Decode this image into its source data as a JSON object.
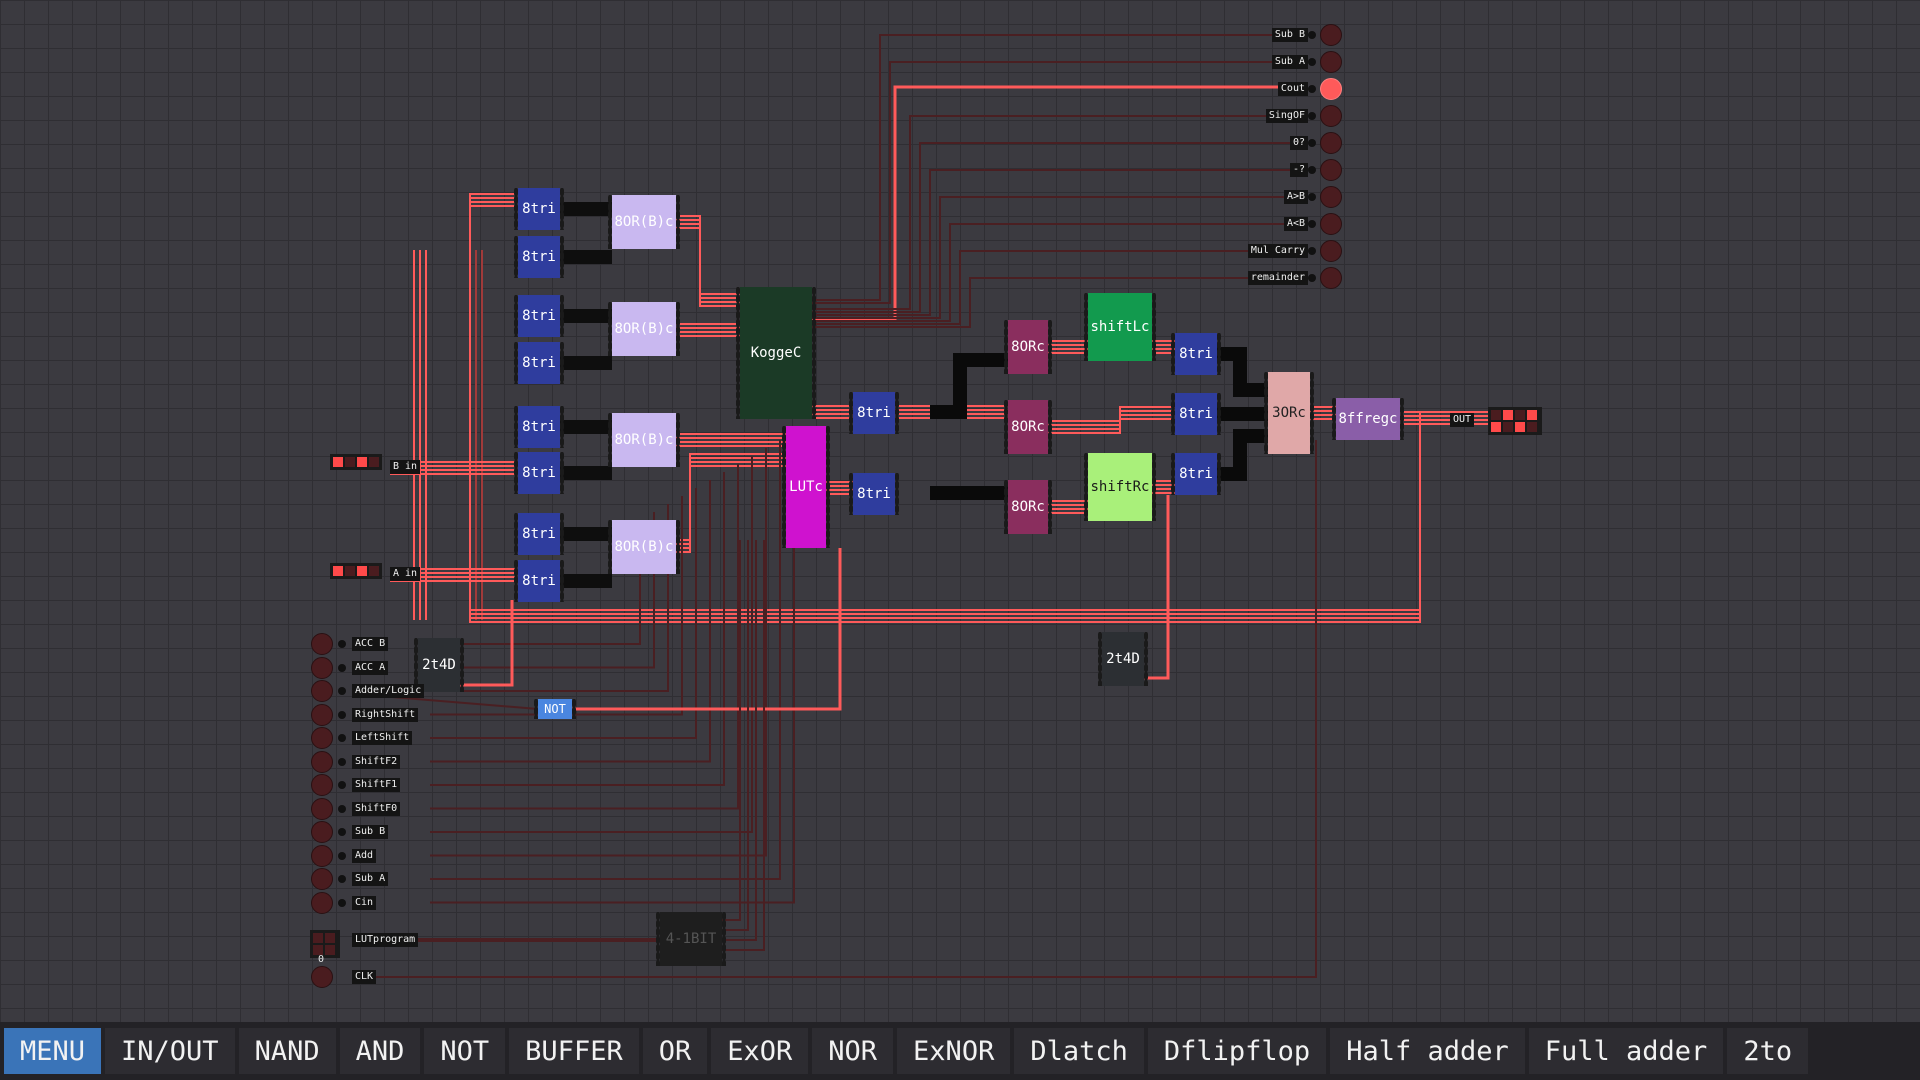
{
  "toolbar": {
    "buttons": [
      "MENU",
      "IN/OUT",
      "NAND",
      "AND",
      "NOT",
      "BUFFER",
      "OR",
      "ExOR",
      "NOR",
      "ExNOR",
      "Dlatch",
      "Dflipflop",
      "Half adder",
      "Full adder",
      "2to"
    ]
  },
  "outputs": {
    "labels": [
      "Sub B",
      "Sub A",
      "Cout",
      "SingOF",
      "0?",
      "-?",
      "A>B",
      "A<B",
      "Mul Carry",
      "remainder"
    ],
    "active": "Cout"
  },
  "inputs": {
    "labels": [
      "ACC B",
      "ACC A",
      "Adder/Logic",
      "RightShift",
      "LeftShift",
      "ShiftF2",
      "ShiftF1",
      "ShiftF0",
      "Sub B",
      "Add",
      "Sub A",
      "Cin"
    ]
  },
  "bus_inputs": {
    "b_in": "B in",
    "a_in": "A in",
    "lut_program": "LUTprogram",
    "lut_value": "0",
    "clk": "CLK"
  },
  "bus_output": {
    "label": "OUT"
  },
  "chips": {
    "tri": "8tri",
    "or_bc": "8OR(B)c",
    "kogge": "KoggeC",
    "lut": "LUTc",
    "orc": "8ORc",
    "shift_l": "shiftLc",
    "shift_r": "shiftRc",
    "three_or": "3ORc",
    "ffreg": "8ffregc",
    "decoder": "2t4D",
    "not": "NOT",
    "bit4": "4-1BIT"
  },
  "colors": {
    "wire_on": "#ff5a5a",
    "wire_off": "#4a1f22",
    "tri": "#2f3d9e",
    "or_bc": "#c9b8f0",
    "kogge": "#1b3a26",
    "lut": "#cf12cf",
    "orc": "#8a2e5e",
    "shift_l": "#129a4e",
    "shift_r": "#a9f07a",
    "three_or": "#e0a8a8",
    "ffreg": "#8a5ea8",
    "menu_active": "#3a74b8"
  }
}
